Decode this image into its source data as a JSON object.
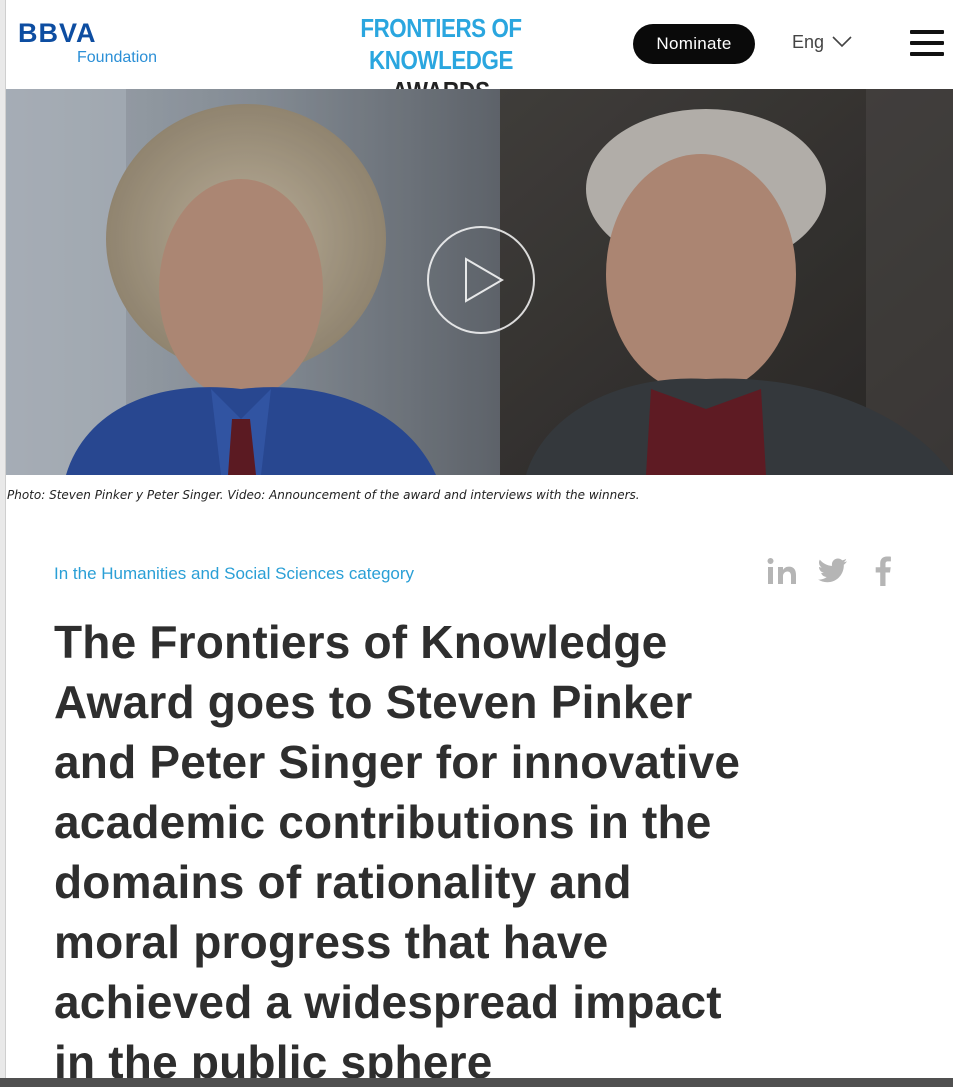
{
  "header": {
    "logo": {
      "brand": "BBVA",
      "sub": "Foundation"
    },
    "site_title_line1": "FRONTIERS OF KNOWLEDGE",
    "site_title_line2": "AWARDS",
    "nominate_label": "Nominate",
    "language": "Eng",
    "language_icon": "chevron-down-icon",
    "menu_icon": "hamburger-menu-icon"
  },
  "hero": {
    "play_icon": "play-icon"
  },
  "caption": "Photo: Steven Pinker y Peter Singer. Video: Announcement of the award and interviews with the winners.",
  "article": {
    "category": "In the Humanities and Social Sciences category",
    "share_icons": [
      "linkedin-icon",
      "twitter-icon",
      "facebook-icon"
    ],
    "headline_lines": [
      "The Frontiers of Knowledge",
      "Award goes to Steven Pinker",
      "and Peter Singer for innovative",
      "academic contributions in the",
      "domains of rationality and",
      "moral progress that have",
      "achieved a widespread impact",
      "in the public sphere"
    ]
  },
  "colors": {
    "brand_blue": "#0d4da1",
    "accent_cyan": "#2aa6df",
    "category_blue": "#2a9fd6",
    "text_dark": "#2e2e2e",
    "button_black": "#0a0a0a",
    "share_gray": "#b5b5b5"
  }
}
